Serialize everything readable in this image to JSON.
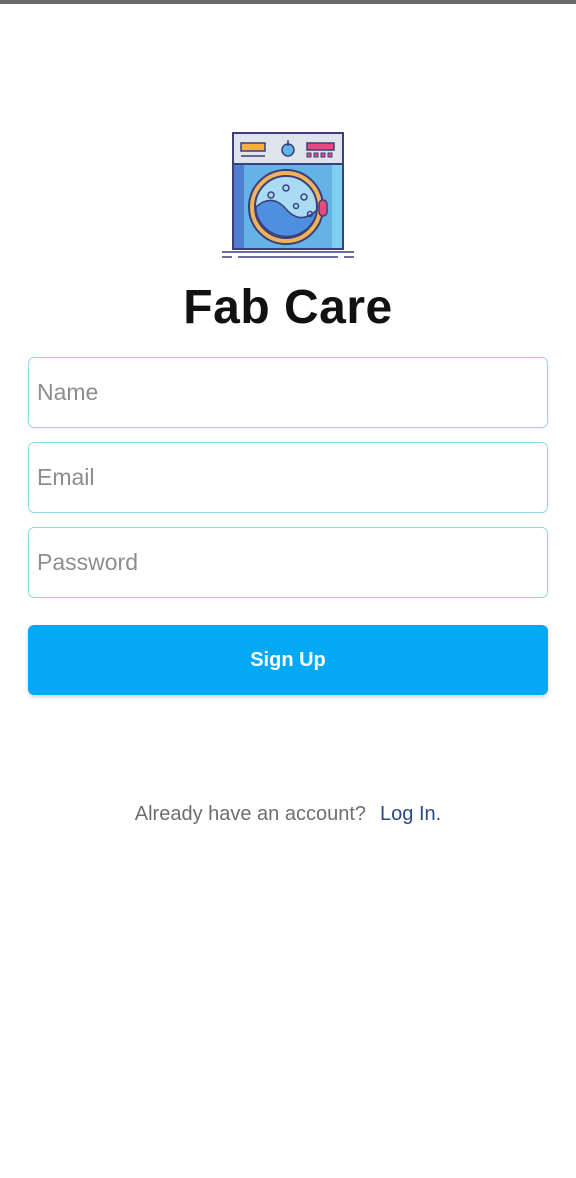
{
  "app": {
    "title": "Fab Care",
    "logo_icon": "washing-machine-icon"
  },
  "form": {
    "name_placeholder": "Name",
    "email_placeholder": "Email",
    "password_placeholder": "Password",
    "name_value": "",
    "email_value": "",
    "password_value": "",
    "submit_label": "Sign Up"
  },
  "footer": {
    "prompt": "Already have an account?",
    "login_link": "Log In."
  },
  "colors": {
    "accent": "#03a9f4",
    "field_border": "#8fd9ec",
    "link": "#2a4a8a",
    "title": "#111111"
  }
}
